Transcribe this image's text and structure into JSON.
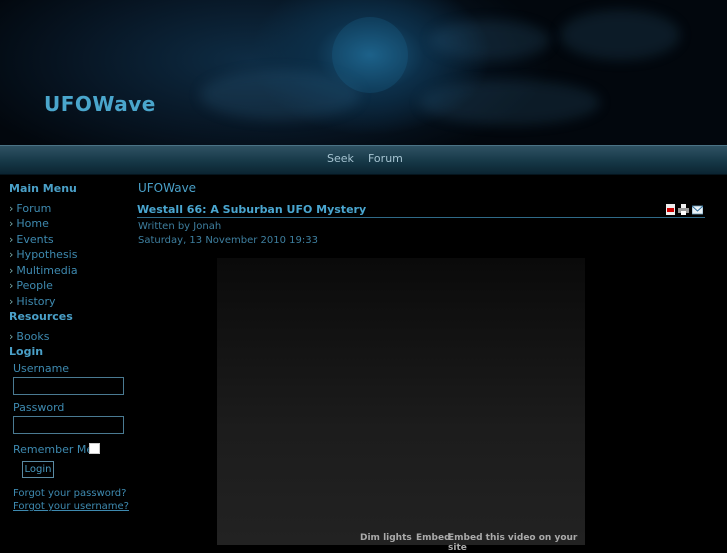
{
  "header": {
    "site_title": "UFOWave"
  },
  "nav": {
    "items": [
      "Seek",
      "Forum"
    ]
  },
  "sidebar": {
    "main_menu_title": "Main Menu",
    "main_menu": [
      "Forum",
      "Home",
      "Events",
      "Hypothesis",
      "Multimedia",
      "People",
      "History"
    ],
    "resources_title": "Resources",
    "resources": [
      "Books"
    ],
    "login_title": "Login",
    "username_label": "Username",
    "password_label": "Password",
    "remember_label": "Remember Me",
    "login_button": "Login",
    "forgot_password": "Forgot your password?",
    "forgot_username": "Forgot your username?"
  },
  "content": {
    "section_title": "UFOWave",
    "article_title": "Westall 66: A Suburban UFO Mystery",
    "author": "Written by Jonah",
    "date": "Saturday, 13 November 2010 19:33",
    "icons": [
      "pdf-icon",
      "print-icon",
      "email-icon"
    ]
  },
  "video": {
    "dim_lights": "Dim lights",
    "embed": "Embed",
    "embed_text": "Embed this video on your site"
  }
}
